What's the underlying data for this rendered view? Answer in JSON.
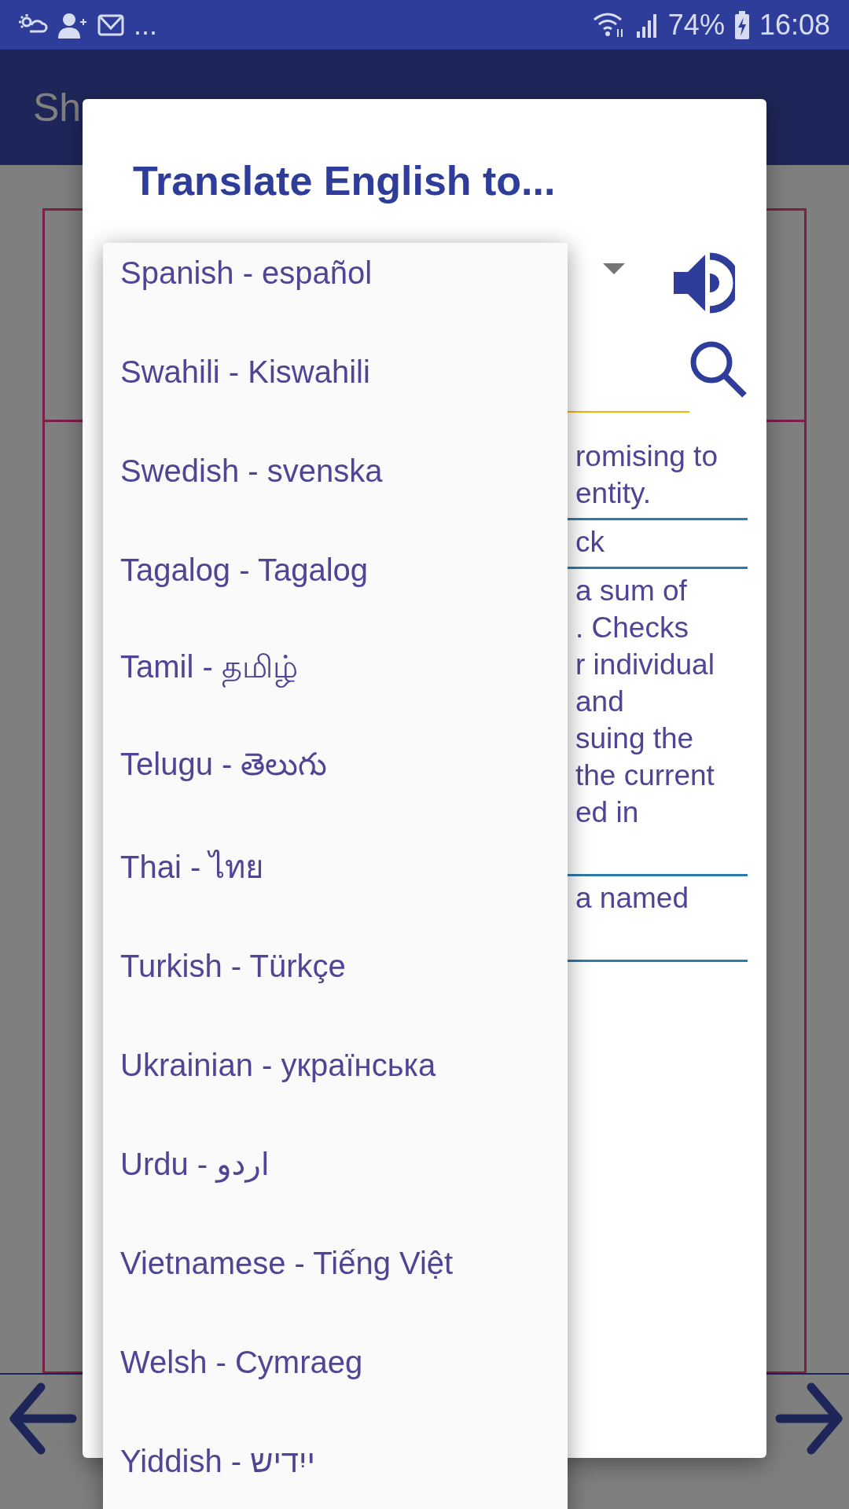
{
  "status_bar": {
    "more": "...",
    "battery": "74%",
    "time": "16:08"
  },
  "app_bar": {
    "title": "Sh"
  },
  "dialog": {
    "title": "Translate English to...",
    "language_dropdown": {
      "expanded": true
    },
    "options": [
      {
        "label": "Spanish - español",
        "selected": false
      },
      {
        "label": "Swahili - Kiswahili",
        "selected": false
      },
      {
        "label": "Swedish - svenska",
        "selected": false
      },
      {
        "label": "Tagalog - Tagalog",
        "selected": false
      },
      {
        "label": "Tamil - தமிழ்",
        "selected": false
      },
      {
        "label": "Telugu - తెలుగు",
        "selected": false
      },
      {
        "label": "Thai - ไทย",
        "selected": false
      },
      {
        "label": "Turkish - Türkçe",
        "selected": false
      },
      {
        "label": "Ukrainian - українська",
        "selected": false
      },
      {
        "label": "Urdu - اردو",
        "selected": false
      },
      {
        "label": "Vietnamese - Tiếng Việt",
        "selected": false
      },
      {
        "label": "Welsh - Cymraeg",
        "selected": false
      },
      {
        "label": "Yiddish - ייִדיש",
        "selected": false
      }
    ],
    "definitions": [
      {
        "lines": [
          "romising to",
          "entity."
        ]
      },
      {
        "lines": [
          "ck"
        ]
      },
      {
        "lines": [
          "a sum of",
          ". Checks",
          "r individual",
          "and",
          "suing the",
          "the current",
          "ed in"
        ]
      },
      {
        "lines": [
          "a named"
        ]
      }
    ]
  }
}
